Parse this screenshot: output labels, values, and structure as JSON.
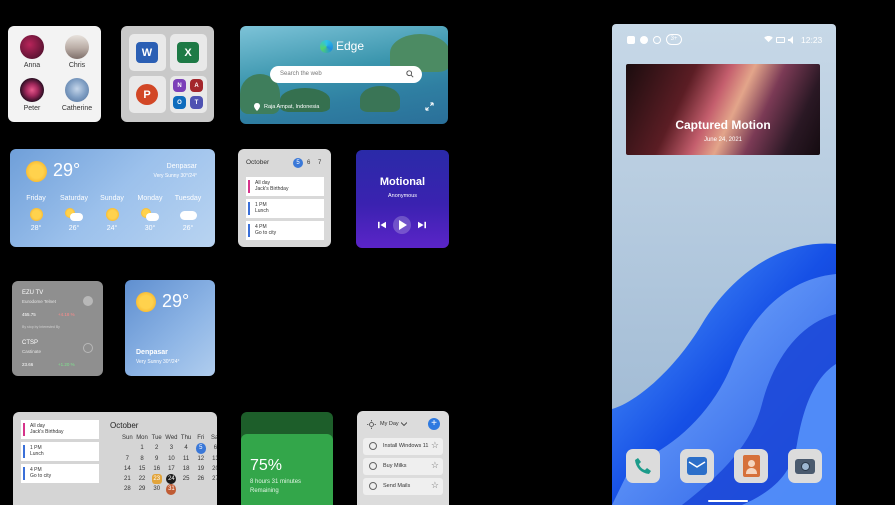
{
  "people": [
    {
      "name": "Anna"
    },
    {
      "name": "Chris"
    },
    {
      "name": "Peter"
    },
    {
      "name": "Catherine"
    }
  ],
  "office_apps": [
    {
      "name": "word-icon",
      "letter": "W"
    },
    {
      "name": "excel-icon",
      "letter": "X"
    },
    {
      "name": "powerpoint-icon",
      "letter": "P"
    },
    {
      "name": "onenote-icon",
      "letter": "N"
    },
    {
      "name": "access-icon",
      "letter": "A"
    },
    {
      "name": "outlook-icon",
      "letter": "O"
    },
    {
      "name": "teams-icon",
      "letter": "T"
    }
  ],
  "edge": {
    "title": "Edge",
    "search_placeholder": "Search the web",
    "location": "Raja Ampat, Indonesia"
  },
  "weather_big": {
    "temp": "29°",
    "city": "Denpasar",
    "condition": "Very Sunny 30°/24°",
    "forecast": [
      {
        "day": "Friday",
        "temp": "28°",
        "icon": "sun"
      },
      {
        "day": "Saturday",
        "temp": "26°",
        "icon": "partly-cloudy"
      },
      {
        "day": "Sunday",
        "temp": "24°",
        "icon": "sun"
      },
      {
        "day": "Monday",
        "temp": "30°",
        "icon": "partly-cloudy"
      },
      {
        "day": "Tuesday",
        "temp": "26°",
        "icon": "cloud"
      }
    ]
  },
  "calendar_small": {
    "month": "October",
    "days": [
      "5",
      "6",
      "7"
    ],
    "events": [
      {
        "time": "All day",
        "title": "Jack's Birthday",
        "color": "#d6338a"
      },
      {
        "time": "1 PM",
        "title": "Lunch",
        "color": "#3a6fd8"
      },
      {
        "time": "4 PM",
        "title": "Go to city",
        "color": "#3a6fd8"
      }
    ]
  },
  "music": {
    "title": "Motional",
    "artist": "Anonymous"
  },
  "stocks": {
    "items": [
      {
        "symbol": "EZU TV",
        "desc": "Eurodome Telnet",
        "price": "455.75",
        "change": "+4.18 %",
        "note": "By stop by Interested By"
      },
      {
        "symbol": "CTSP",
        "desc": "Castinate",
        "price": "23.66",
        "change": "+1.20 %"
      }
    ]
  },
  "weather_small": {
    "temp": "29°",
    "city": "Denpasar",
    "condition": "Very Sunny 30°/24°"
  },
  "calendar_big": {
    "month": "October",
    "weekdays": [
      "Sun",
      "Mon",
      "Tue",
      "Wed",
      "Thu",
      "Fri",
      "Sat"
    ],
    "weeks": [
      [
        "",
        "",
        "",
        "",
        "",
        "",
        ""
      ],
      [
        "",
        "1",
        "2",
        "3",
        "4",
        "5",
        "6"
      ],
      [
        "7",
        "8",
        "9",
        "10",
        "11",
        "12",
        "13"
      ],
      [
        "14",
        "15",
        "16",
        "17",
        "18",
        "19",
        "20"
      ],
      [
        "21",
        "22",
        "23",
        "24",
        "25",
        "26",
        "27"
      ],
      [
        "28",
        "29",
        "30",
        "31",
        "",
        "",
        ""
      ]
    ],
    "events": [
      {
        "time": "All day",
        "title": "Jack's Birthday",
        "color": "#d6338a"
      },
      {
        "time": "1 PM",
        "title": "Lunch",
        "color": "#3a6fd8"
      },
      {
        "time": "4 PM",
        "title": "Go to city",
        "color": "#3a6fd8"
      }
    ]
  },
  "battery": {
    "percent": "75%",
    "time_left": "8 hours 31 minutes",
    "status": "Remaining",
    "level": 0.75
  },
  "todo": {
    "title": "My Day",
    "tasks": [
      "Install Windows 11",
      "Buy Milks",
      "Send Mails"
    ]
  },
  "phone": {
    "time": "12:23",
    "notification_count": "3+",
    "wallpaper_title": "Captured Motion",
    "wallpaper_date": "June 24, 2021",
    "dock": [
      "phone-icon",
      "mail-icon",
      "contacts-icon",
      "camera-icon"
    ]
  }
}
